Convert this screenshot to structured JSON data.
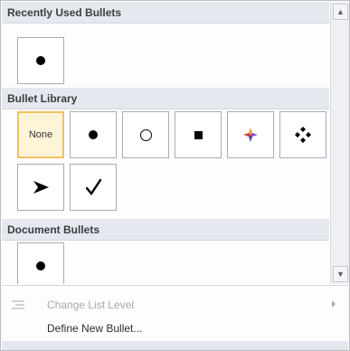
{
  "sections": {
    "recently_used": "Recently Used Bullets",
    "library": "Bullet Library",
    "document": "Document Bullets"
  },
  "library": {
    "none_label": "None",
    "icons": [
      "filled-circle-bullet-icon",
      "hollow-circle-bullet-icon",
      "square-bullet-icon",
      "colorful-star-bullet-icon",
      "diamond-cluster-bullet-icon",
      "arrowhead-bullet-icon",
      "checkmark-bullet-icon"
    ]
  },
  "menu": {
    "change_list_level": "Change List Level",
    "define_new_bullet": "Define New Bullet..."
  }
}
